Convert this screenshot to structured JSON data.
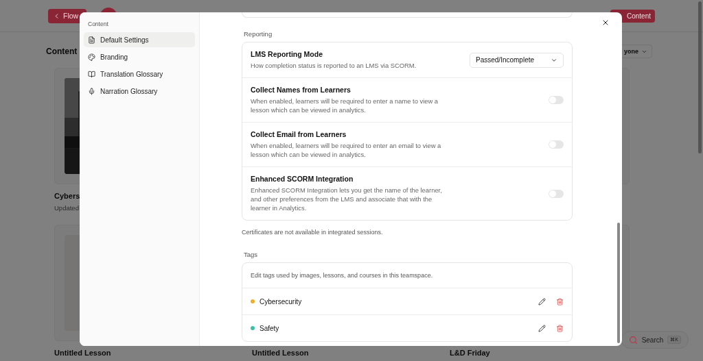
{
  "background": {
    "back_button": "Flow",
    "header_button": "Content",
    "page_title": "Content",
    "filter": "yone",
    "card_rows": [
      [
        {
          "kind": "picture",
          "title": "Cybers",
          "subtitle": "Updated"
        }
      ],
      [
        {
          "title": "Untitled Lesson"
        },
        {
          "title": "Untitled Lesson"
        },
        {
          "title": "L&D Friday"
        }
      ]
    ],
    "search": {
      "label": "Search",
      "shortcut": "⌘K"
    }
  },
  "modal": {
    "sidebar": {
      "heading": "Content",
      "items": [
        {
          "label": "Default Settings",
          "selected": true
        },
        {
          "label": "Branding",
          "selected": false
        },
        {
          "label": "Translation Glossary",
          "selected": false
        },
        {
          "label": "Narration Glossary",
          "selected": false
        }
      ]
    },
    "reporting": {
      "heading": "Reporting",
      "rows": [
        {
          "kind": "select",
          "title": "LMS Reporting Mode",
          "description": "How completion status is reported to an LMS via SCORM.",
          "value": "Passed/Incomplete"
        },
        {
          "kind": "toggle",
          "title": "Collect Names from Learners",
          "description": "When enabled, learners will be required to enter a name to view a lesson which can be viewed in analytics.",
          "on": false
        },
        {
          "kind": "toggle",
          "title": "Collect Email from Learners",
          "description": "When enabled, learners will be required to enter an email to view a lesson which can be viewed in analytics.",
          "on": false
        },
        {
          "kind": "toggle",
          "title": "Enhanced SCORM Integration",
          "description": "Enhanced SCORM Integration lets you get the name of the learner, and other preferences from the LMS and associate that with the learner in Analytics.",
          "on": false
        }
      ],
      "note": "Certificates are not available in integrated sessions."
    },
    "tags": {
      "heading": "Tags",
      "description": "Edit tags used by images, lessons, and courses in this teamspace.",
      "items": [
        {
          "name": "Cybersecurity",
          "color": "#e8b02c"
        },
        {
          "name": "Safety",
          "color": "#3dbfa6"
        }
      ]
    }
  }
}
